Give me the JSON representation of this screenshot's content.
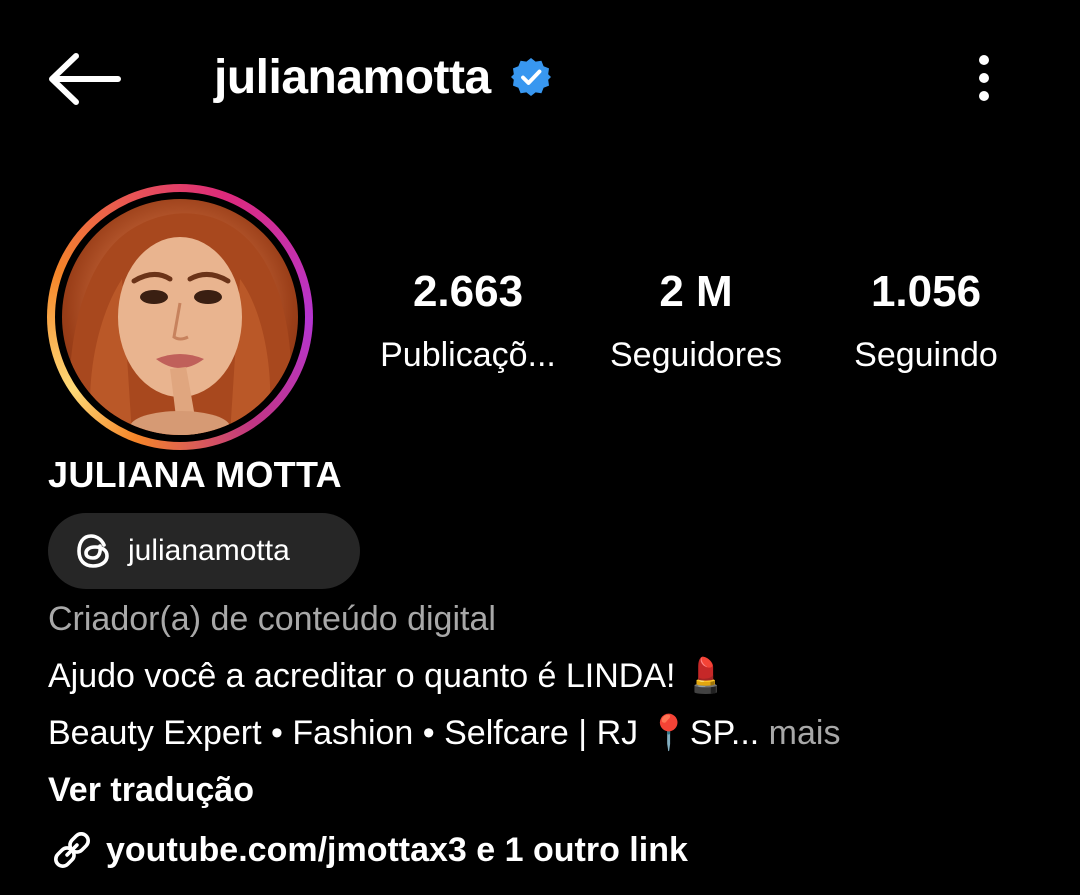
{
  "header": {
    "username": "julianamotta",
    "verified": true,
    "back_icon": "arrow-left-icon",
    "more_icon": "vertical-dots-icon"
  },
  "stats": {
    "posts": {
      "value": "2.663",
      "label": "Publicaçõ..."
    },
    "followers": {
      "value": "2 M",
      "label": "Seguidores"
    },
    "following": {
      "value": "1.056",
      "label": "Seguindo"
    }
  },
  "profile": {
    "full_name": "JULIANA MOTTA",
    "threads_handle": "julianamotta",
    "category": "Criador(a) de conteúdo digital",
    "bio_line1": "Ajudo você a acreditar o quanto é LINDA! 💄",
    "bio_line2": "Beauty Expert • Fashion • Selfcare | RJ 📍SP...",
    "more_label": " mais",
    "translate_label": "Ver tradução",
    "link_text": "youtube.com/jmottax3 e 1 outro link"
  },
  "colors": {
    "background": "#000000",
    "verified_blue": "#3897f0",
    "muted_text": "#a8a8a8",
    "pill_bg": "#262626"
  }
}
